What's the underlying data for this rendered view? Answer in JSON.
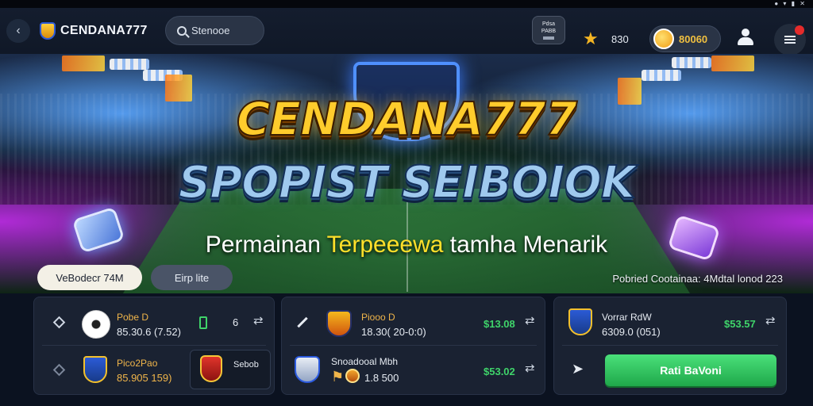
{
  "header": {
    "back_icon": "chevron-left-icon",
    "brand_name": "CENDANA777",
    "search_placeholder": "Stenooe",
    "badge_line1": "Pdsa",
    "badge_line2": "PABB",
    "points": "830",
    "coins": "80060"
  },
  "hero": {
    "title": "CENDANA777",
    "subtitle": "SPOPIST SEIBOIOK",
    "tagline_pre": "Permainan ",
    "tagline_highlight": "Terpeeewa",
    "tagline_post": " tamha Menarik",
    "chip_primary": "VeBodecr 74M",
    "chip_secondary": "Eirp lite",
    "right_text": "Pobried Cootainaa: 4Mdtal lonod 223"
  },
  "cards": {
    "card1": {
      "row1": {
        "name": "Pobe D",
        "odds": "85.30.6 (7.52)",
        "num": "6"
      },
      "row2": {
        "name": "Pico2Pao",
        "odds": "85.905 159)",
        "sub_label": "Sebob"
      }
    },
    "card2": {
      "row1": {
        "name": "Piooo D",
        "odds": "18.30( 20-0:0)",
        "green": "$13.08"
      },
      "row2": {
        "name": "Snoadooal Mbh",
        "odds": "1.8 500",
        "green": "$53.02"
      }
    },
    "card3": {
      "row1": {
        "name": "Vorrar RdW",
        "odds": "6309.0 (051)",
        "green": "$53.57"
      },
      "cta": "Rati BaVoni"
    }
  }
}
